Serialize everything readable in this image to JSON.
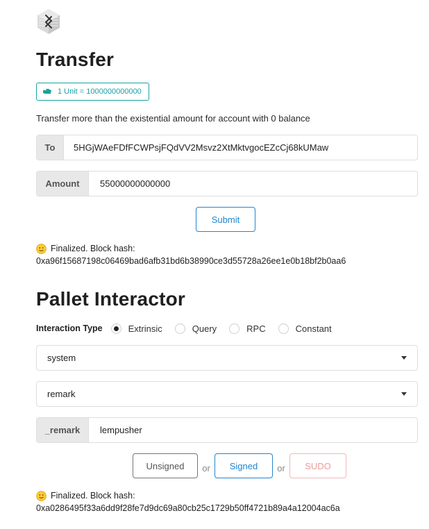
{
  "transfer": {
    "title": "Transfer",
    "unit_badge": "1 Unit = 1000000000000",
    "note": "Transfer more than the existential amount for account with 0 balance",
    "to_label": "To",
    "to_value": "5HGjWAeFDfFCWPsjFQdVV2Msvz2XtMktvgocEZcCj68kUMaw",
    "amount_label": "Amount",
    "amount_value": "55000000000000",
    "submit_label": "Submit",
    "status_line": "Finalized. Block hash:",
    "status_hash": "0xa96f15687198c06469bad6afb31bd6b38990ce3d55728a26ee1e0b18bf2b0aa6"
  },
  "pallet": {
    "title": "Pallet Interactor",
    "interaction_type_label": "Interaction Type",
    "interaction_types": [
      {
        "label": "Extrinsic",
        "selected": true
      },
      {
        "label": "Query",
        "selected": false
      },
      {
        "label": "RPC",
        "selected": false
      },
      {
        "label": "Constant",
        "selected": false
      }
    ],
    "pallet_select": "system",
    "call_select": "remark",
    "param_label": "_remark",
    "param_value": "lempusher",
    "buttons": {
      "unsigned": "Unsigned",
      "or": "or",
      "signed": "Signed",
      "sudo": "SUDO"
    },
    "status_line": "Finalized. Block hash:",
    "status_hash": "0xa0286495f33a6dd9f28fe7d9dc69a80cb25c1729b50ff4721b89a4a12004ac6a"
  },
  "colors": {
    "teal": "#17a2a2",
    "blue": "#2185d0",
    "sudo_red": "#f09a9a"
  }
}
